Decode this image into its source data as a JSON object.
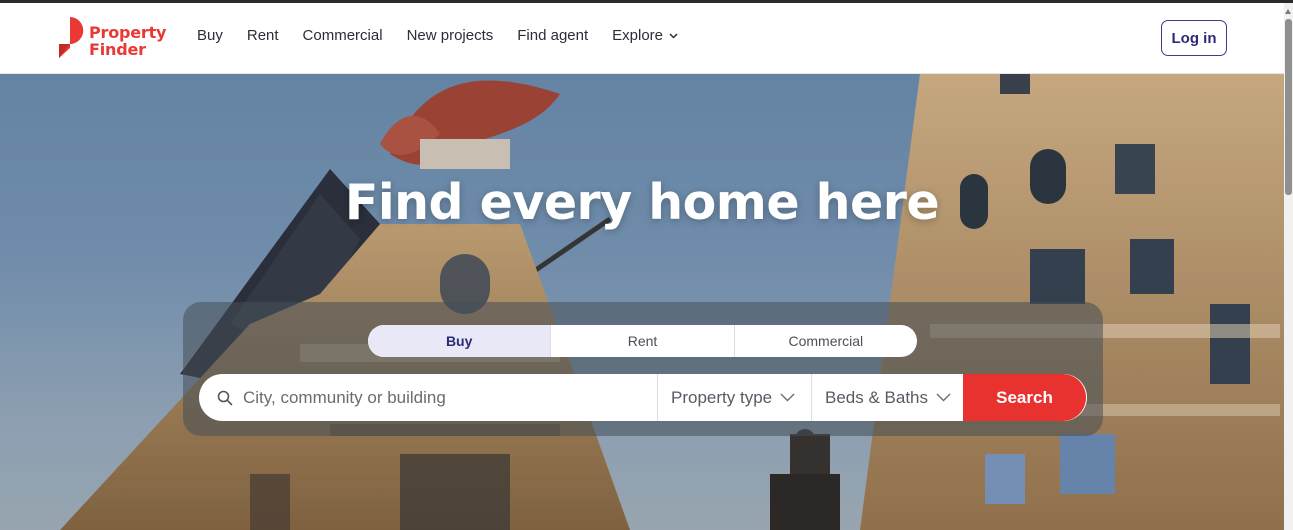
{
  "brand": {
    "name_line1": "Property",
    "name_line2": "Finder",
    "color": "#ea3934"
  },
  "nav": {
    "items": [
      {
        "label": "Buy"
      },
      {
        "label": "Rent"
      },
      {
        "label": "Commercial"
      },
      {
        "label": "New projects"
      },
      {
        "label": "Find agent"
      },
      {
        "label": "Explore",
        "icon": "chevron-down-icon"
      }
    ],
    "login_label": "Log in"
  },
  "hero": {
    "title": "Find every home here",
    "tabs": [
      {
        "label": "Buy",
        "active": true
      },
      {
        "label": "Rent",
        "active": false
      },
      {
        "label": "Commercial",
        "active": false
      }
    ],
    "search": {
      "placeholder": "City, community or building",
      "value": "",
      "property_type_label": "Property type",
      "beds_baths_label": "Beds & Baths",
      "button_label": "Search",
      "button_color": "#e8322f"
    }
  },
  "colors": {
    "accent_dark": "#2b2b7a",
    "active_tab_bg": "#e9e8f6"
  }
}
